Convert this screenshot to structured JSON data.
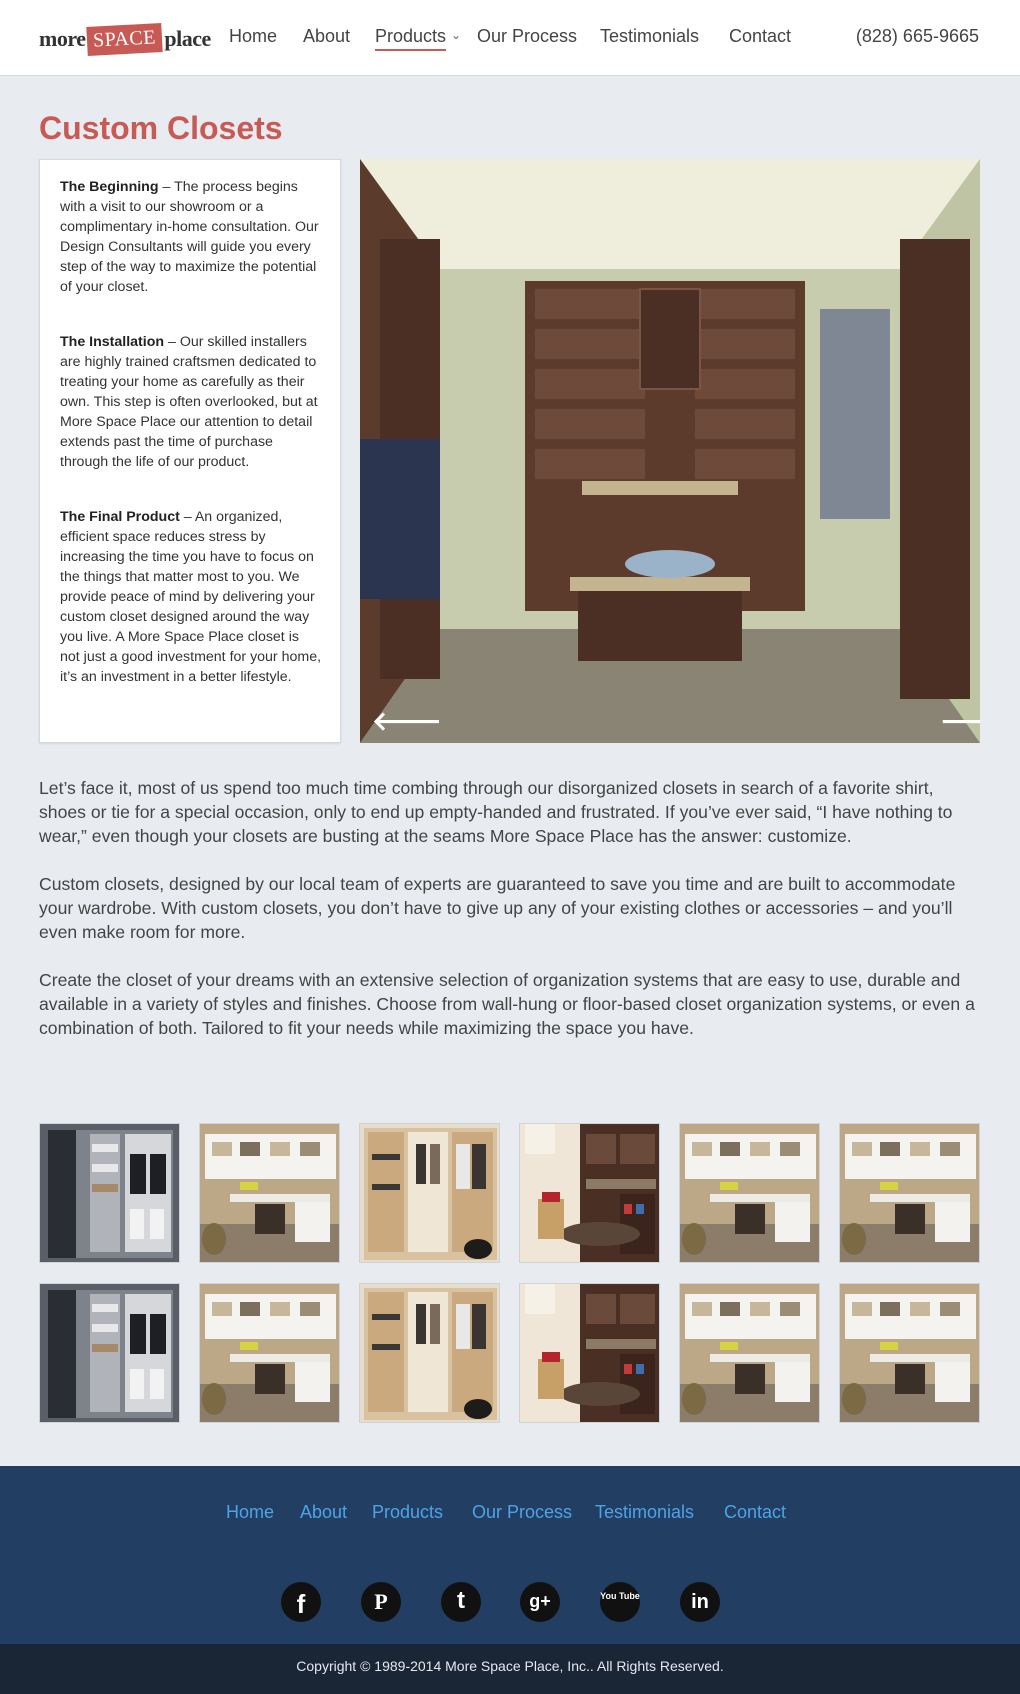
{
  "header": {
    "logo": {
      "more": "more",
      "space": "SPACE",
      "place": "place"
    },
    "nav": [
      {
        "label": "Home"
      },
      {
        "label": "About"
      },
      {
        "label": "Products",
        "active": true
      },
      {
        "label": "Our Process"
      },
      {
        "label": "Testimonials"
      },
      {
        "label": "Contact"
      }
    ],
    "phone": "(828) 665-9665"
  },
  "colors": {
    "accent": "#c85a55",
    "footer_bg": "#223f63",
    "footer_link": "#4da3e6",
    "copyright_bg": "#1a2535",
    "page_bg": "#e8ebf0"
  },
  "main": {
    "title": "Custom Closets",
    "sidebar": [
      {
        "heading": "The Beginning",
        "sep": " – ",
        "text": "The process begins with a visit to our showroom or a complimentary in-home consultation. Our Design Consultants will guide you every step of the way to maximize the potential of your closet."
      },
      {
        "heading": "The Installation",
        "sep": " – ",
        "text": "Our skilled installers are highly trained craftsmen dedicated to treating your home as carefully as their own. This step is often overlooked, but at More Space Place our attention to detail extends past the time of purchase through the life of our product."
      },
      {
        "heading": "The Final Product",
        "sep": " – ",
        "text": "An organized, efficient space reduces stress by increasing the time you have to focus on the things that matter most to you. We provide peace of mind by delivering your custom closet designed around the way you live. A More Space Place closet is not just a good investment for your home, it’s an investment in a better lifestyle."
      }
    ],
    "slider": {
      "prev_icon": "arrow-left-icon",
      "next_icon": "arrow-right-icon",
      "prev_glyph": "🡐",
      "next_glyph": "🡒"
    },
    "paragraphs": [
      "Let’s face it, most of us spend too much time combing through our disorganized closets in search of a favorite shirt, shoes or tie for a special occasion, only to end up empty-handed and frustrated. If you’ve ever said, “I have nothing to wear,” even though your closets are busting at the seams More Space Place has the answer: customize.",
      "Custom closets, designed by our local team of experts are guaranteed to save you time and are built to accommodate your wardrobe. With custom closets, you don’t have to give up any of your existing clothes or accessories – and you’ll even make room for more.",
      "Create the closet of your dreams with an extensive selection of organization systems that are easy to use, durable and available in a variety of styles and finishes. Choose from wall-hung or floor-based closet organization systems, or even a combination of both. Tailored to fit your needs while maximizing the space you have."
    ],
    "thumbnails": [
      "dark-closet",
      "white-office",
      "maple-closet",
      "espresso-office",
      "white-office",
      "white-office",
      "dark-closet",
      "white-office",
      "maple-closet",
      "espresso-office",
      "white-office",
      "white-office"
    ]
  },
  "footer": {
    "nav": [
      {
        "label": "Home"
      },
      {
        "label": "About"
      },
      {
        "label": "Products"
      },
      {
        "label": "Our Process"
      },
      {
        "label": "Testimonials"
      },
      {
        "label": "Contact"
      }
    ],
    "social": [
      {
        "icon": "facebook-icon",
        "glyph": "f"
      },
      {
        "icon": "pinterest-icon",
        "glyph": "P"
      },
      {
        "icon": "twitter-icon",
        "glyph": "t"
      },
      {
        "icon": "google-plus-icon",
        "glyph": "g+"
      },
      {
        "icon": "youtube-icon",
        "glyph": "You Tube"
      },
      {
        "icon": "linkedin-icon",
        "glyph": "in"
      }
    ],
    "copyright": "Copyright © 1989-2014 More Space Place, Inc.. All Rights Reserved."
  }
}
